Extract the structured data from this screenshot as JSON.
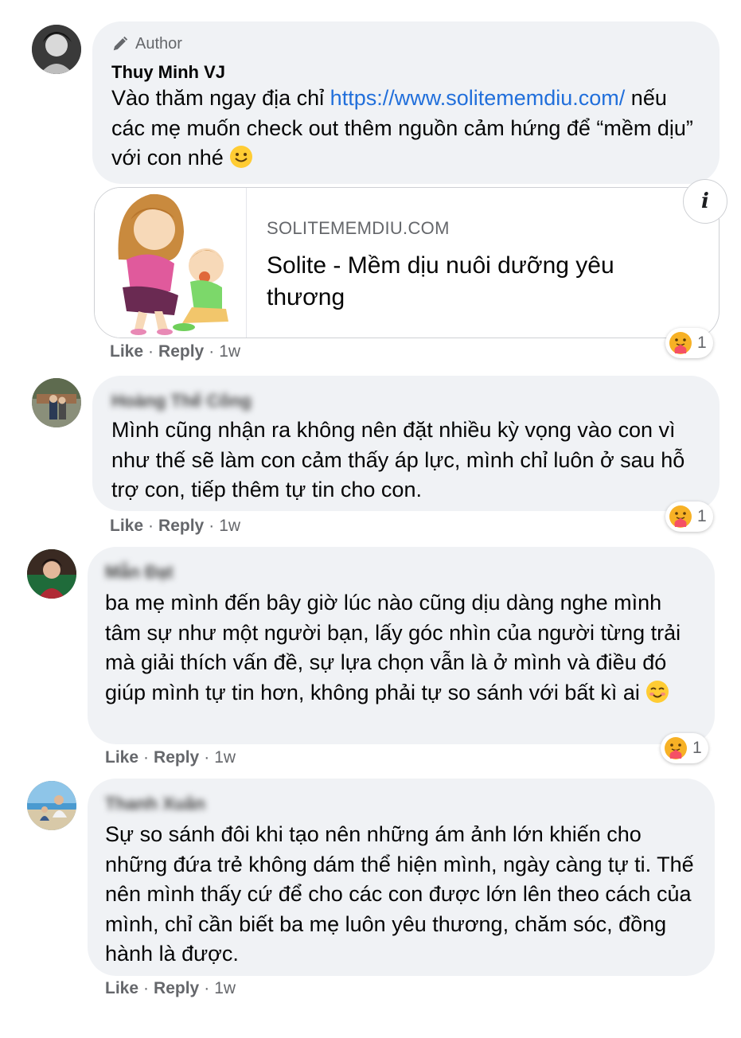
{
  "comments": [
    {
      "author_badge": "Author",
      "name": "Thuy Minh VJ",
      "text_before_link": "Vào thăm ngay địa chỉ ",
      "link": "https://www.solitememdiu.com/",
      "text_after_link": " nếu các mẹ muốn check out thêm nguồn cảm hứng để “mềm dịu” với con nhé",
      "link_preview": {
        "domain": "SOLITEMEMDIU.COM",
        "title": "Solite - Mềm dịu nuôi dưỡng yêu thương",
        "info_icon": "i"
      },
      "reaction_count": "1",
      "like": "Like",
      "reply": "Reply",
      "time": "1w"
    },
    {
      "name": "Hoàng Thế Công",
      "text": "Mình cũng nhận ra không nên đặt nhiều kỳ vọng vào con vì như thế sẽ làm con cảm thấy áp lực, mình chỉ luôn ở sau hỗ trợ con, tiếp thêm tự tin cho con.",
      "reaction_count": "1",
      "like": "Like",
      "reply": "Reply",
      "time": "1w"
    },
    {
      "name": "Mẫn Đạt",
      "text": "ba mẹ mình đến bây giờ lúc nào cũng dịu dàng nghe mình tâm sự như một người bạn, lấy góc nhìn của người từng trải mà giải thích vấn đề, sự lựa chọn vẫn là ở mình và điều đó giúp mình tự tin hơn, không phải tự so sánh với bất kì ai",
      "reaction_count": "1",
      "like": "Like",
      "reply": "Reply",
      "time": "1w"
    },
    {
      "name": "Thanh Xuân",
      "text": "Sự so sánh đôi khi tạo nên những ám ảnh lớn khiến cho những đứa trẻ không dám thể hiện mình, ngày càng tự ti. Thế nên mình thấy cứ để cho các con được lớn lên theo cách của mình, chỉ cần biết ba mẹ luôn yêu thương, chăm sóc, đồng hành là được.",
      "like": "Like",
      "reply": "Reply",
      "time": "1w"
    }
  ],
  "colors": {
    "bubble": "#f0f2f5",
    "link": "#216fdb",
    "secondary_text": "#65676b"
  },
  "icons": {
    "author": "pencil-icon",
    "reaction": "care-reaction-icon",
    "smile": "smile-emoji-icon",
    "blush": "blush-emoji-icon",
    "info": "info-icon"
  }
}
